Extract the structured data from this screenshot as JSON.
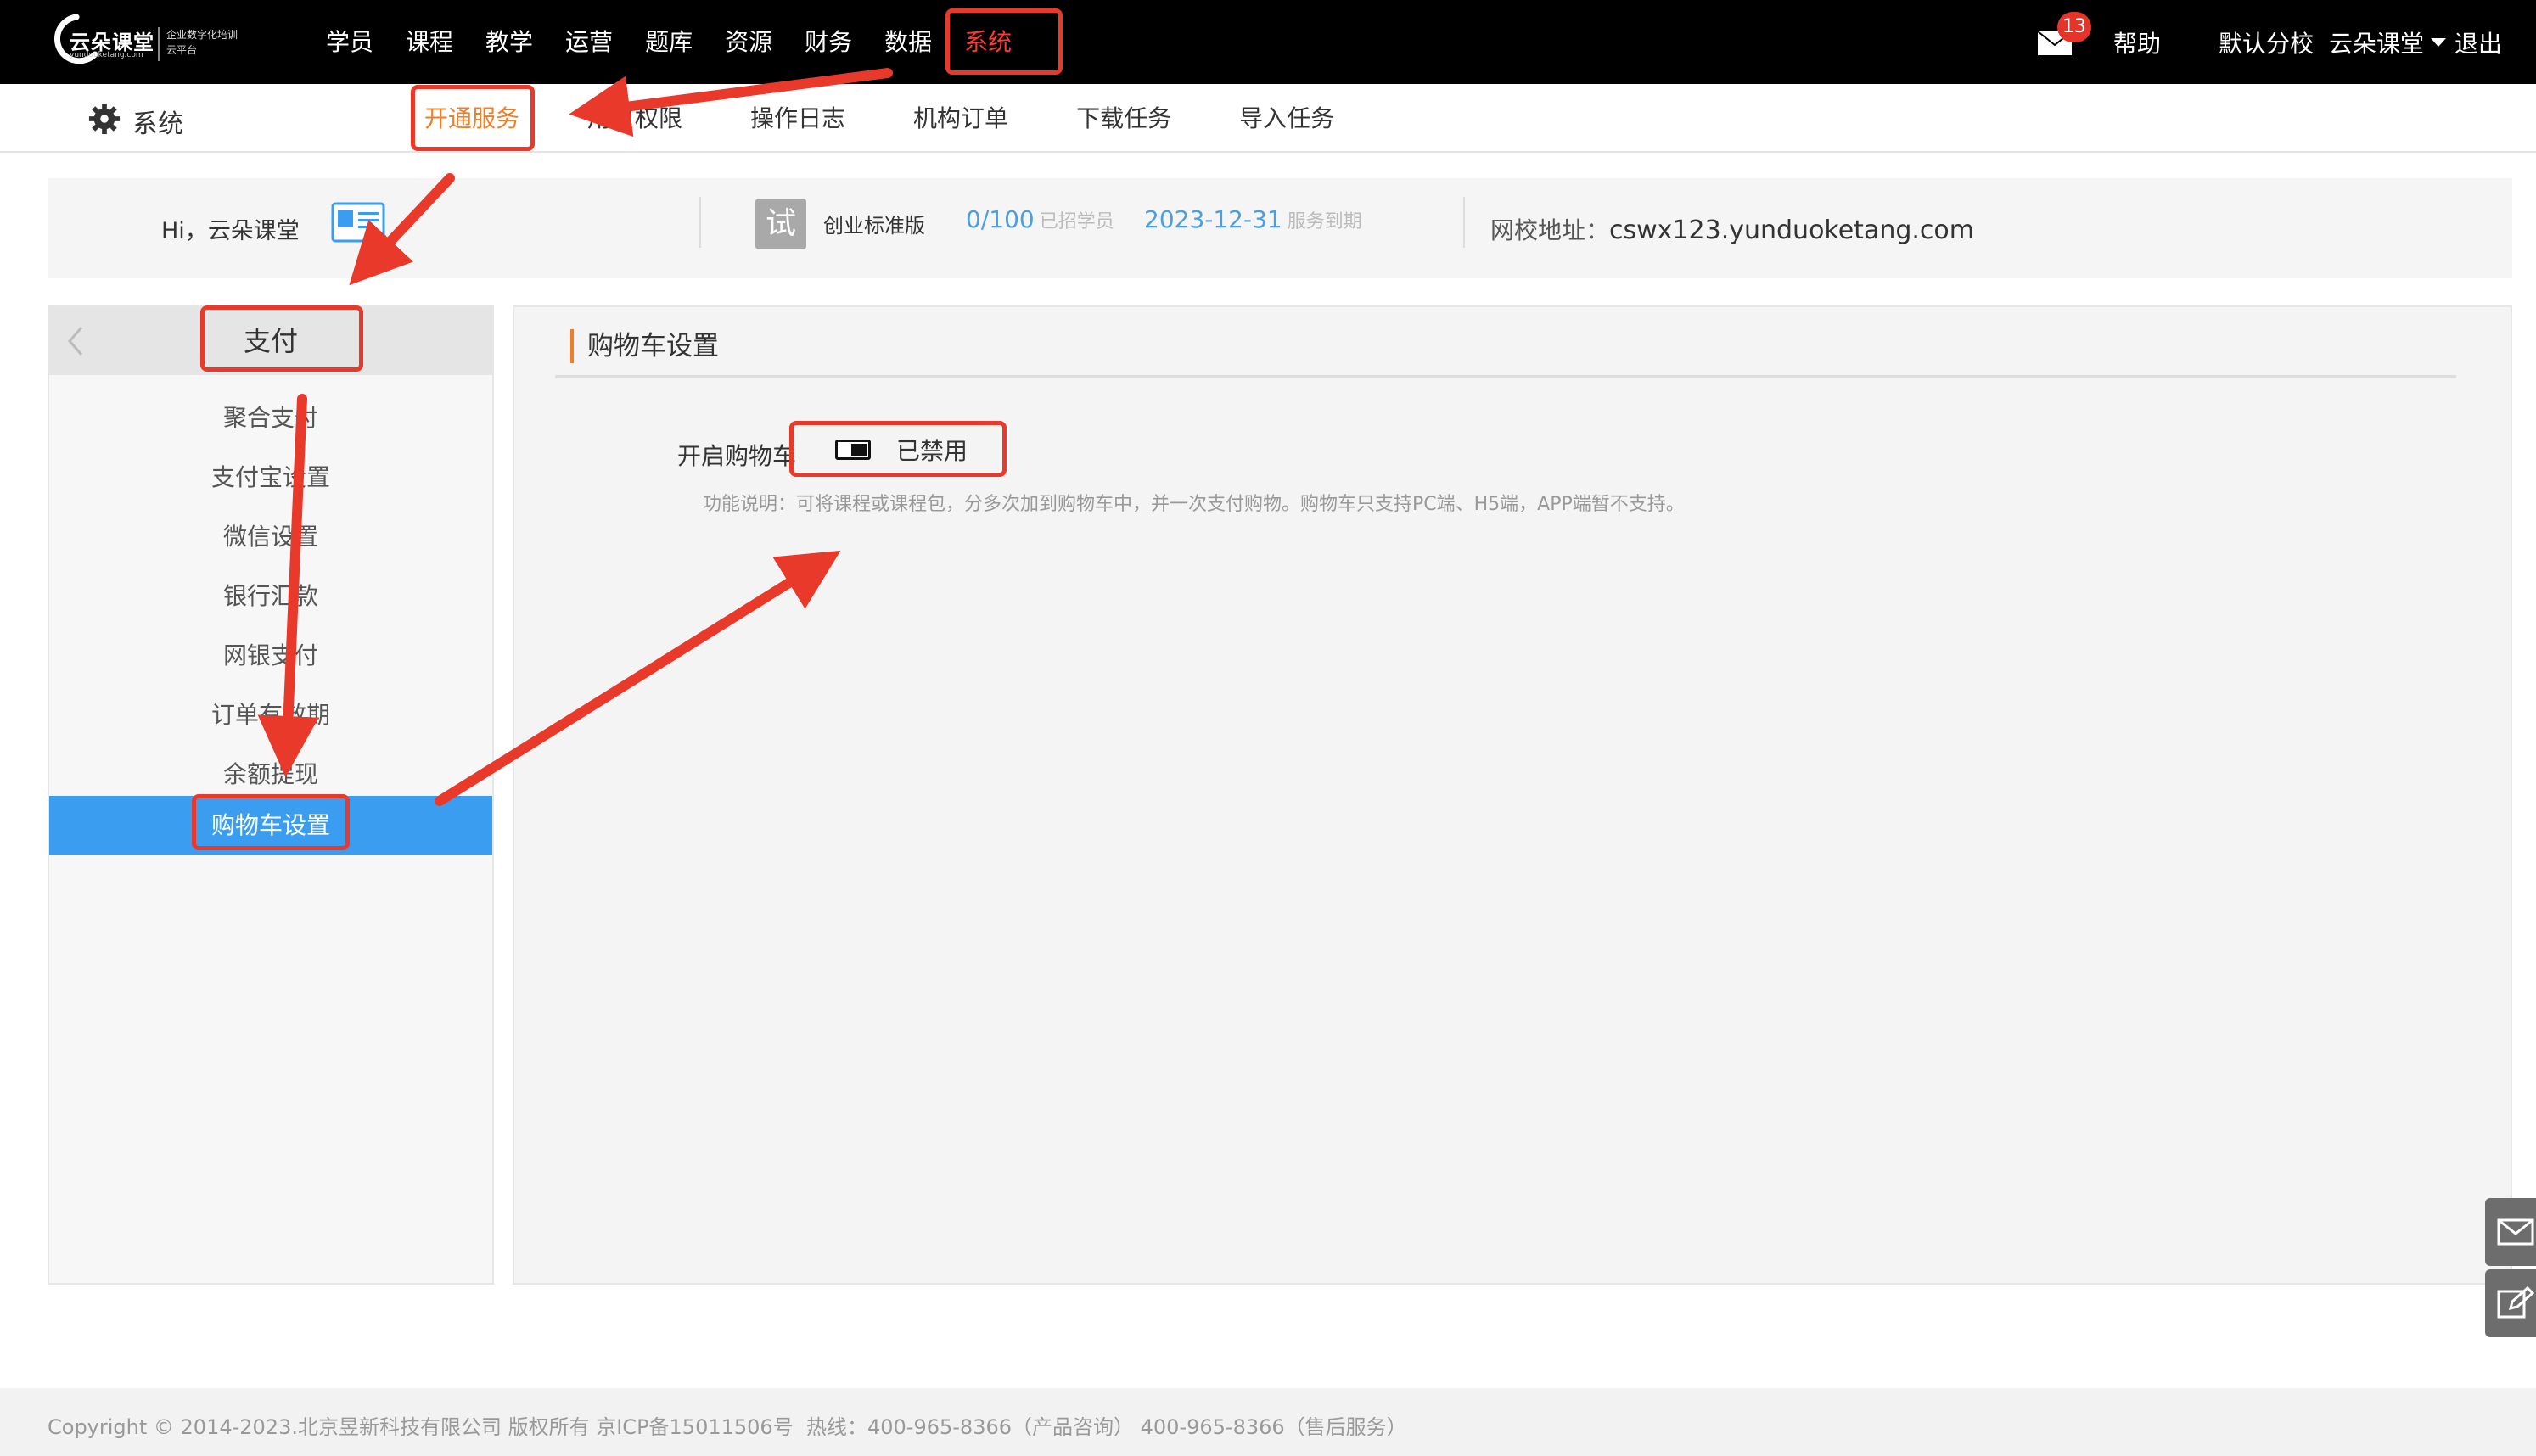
{
  "topbar": {
    "logo": {
      "brand": "云朵课堂",
      "domain": "yunduoketang.com",
      "slogan": "企业数字化培训云平台"
    },
    "nav": [
      {
        "label": "学员"
      },
      {
        "label": "课程"
      },
      {
        "label": "教学"
      },
      {
        "label": "运营"
      },
      {
        "label": "题库"
      },
      {
        "label": "资源"
      },
      {
        "label": "财务"
      },
      {
        "label": "数据"
      },
      {
        "label": "系统",
        "active": true
      }
    ],
    "mail_badge": "13",
    "help": "帮助",
    "school": "默认分校",
    "user": "云朵课堂",
    "logout": "退出"
  },
  "subbar": {
    "title": "系统",
    "tabs": [
      {
        "label": "开通服务",
        "active": true
      },
      {
        "label": "用户权限"
      },
      {
        "label": "操作日志"
      },
      {
        "label": "机构订单"
      },
      {
        "label": "下载任务"
      },
      {
        "label": "导入任务"
      }
    ]
  },
  "info": {
    "greeting": "Hi，",
    "name": "云朵课堂",
    "trial_badge": "试",
    "edition": "创业标准版",
    "students_value": "0/100",
    "students_label": "已招学员",
    "expiry_value": "2023-12-31",
    "expiry_label": "服务到期",
    "site_label": "网校地址：",
    "site_url": "cswx123.yunduoketang.com"
  },
  "menu": {
    "head": "支付",
    "items": [
      {
        "label": "聚合支付"
      },
      {
        "label": "支付宝设置"
      },
      {
        "label": "微信设置"
      },
      {
        "label": "银行汇款"
      },
      {
        "label": "网银支付"
      },
      {
        "label": "订单有效期"
      },
      {
        "label": "余额提现"
      },
      {
        "label": "购物车设置",
        "active": true
      }
    ]
  },
  "panel": {
    "title": "购物车设置",
    "field_label": "开启购物车",
    "toggle_state": "已禁用",
    "toggle_on": false,
    "note": "功能说明：可将课程或课程包，分多次加到购物车中，并一次支付购物。购物车只支持PC端、H5端，APP端暂不支持。"
  },
  "footer": {
    "copyright": "Copyright © 2014-2023.北京昱新科技有限公司 版权所有 京ICP备15011506号",
    "hotline": "热线：400-965-8366（产品咨询） 400-965-8366（售后服务）"
  },
  "colors": {
    "accent": "#f07d28",
    "active_nav": "#ff3b30",
    "menu_active": "#3a9df0",
    "annotation": "#e8392b",
    "info_blue": "#4a9fe0"
  }
}
